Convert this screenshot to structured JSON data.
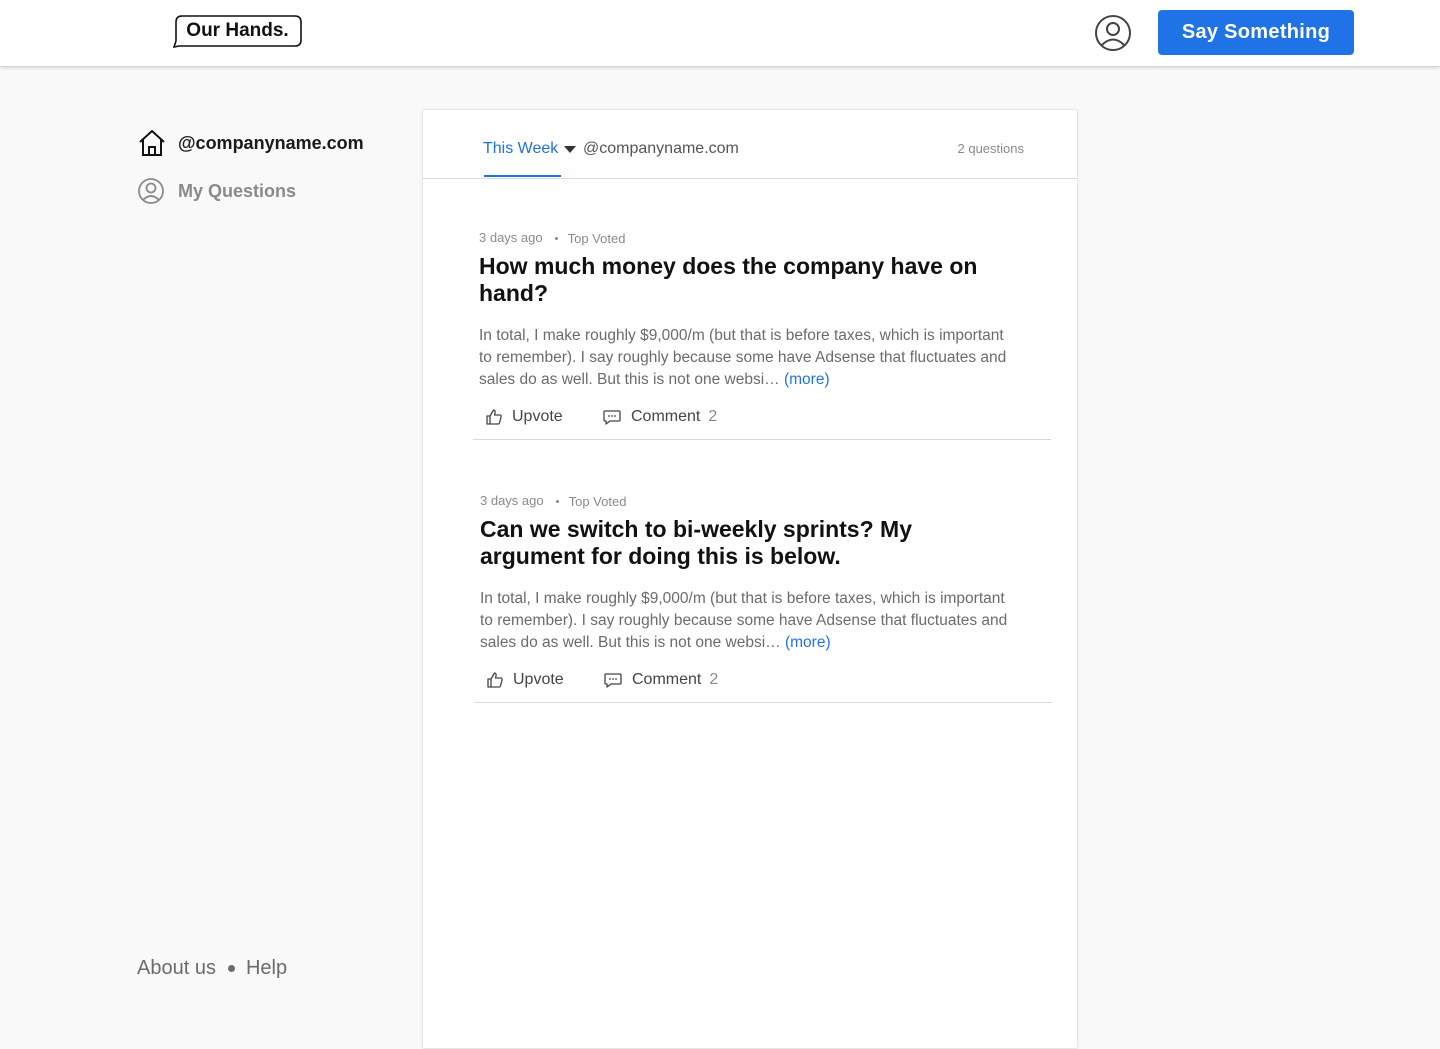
{
  "header": {
    "logo_text": "Our Hands.",
    "cta_label": "Say Something"
  },
  "sidebar": {
    "items": [
      {
        "label": "@companyname.com",
        "icon": "home-icon"
      },
      {
        "label": "My Questions",
        "icon": "user-circle-icon"
      }
    ]
  },
  "feed": {
    "filter_label": "This Week",
    "scope_label": "@companyname.com",
    "question_count": "2 questions",
    "posts": [
      {
        "age": "3 days ago",
        "tag": "Top Voted",
        "title": "How much money does the company have on hand?",
        "body": "In total, I make roughly $9,000/m (but that is before taxes, which is important to remember). I say roughly because some have Adsense that fluctuates and sales do as well. But this is not one websi… ",
        "more": "(more)",
        "upvote": "Upvote",
        "comment": "Comment",
        "comment_count": "2"
      },
      {
        "age": "3 days ago",
        "tag": "Top Voted",
        "title": "Can we switch to bi-weekly sprints? My argument for doing this is below.",
        "body": "In total, I make roughly $9,000/m (but that is before taxes, which is important to remember). I say roughly because some have Adsense that fluctuates and sales do as well. But this is not one websi… ",
        "more": "(more)",
        "upvote": "Upvote",
        "comment": "Comment",
        "comment_count": "2"
      }
    ]
  },
  "footer": {
    "about": "About us",
    "help": "Help"
  },
  "colors": {
    "accent": "#1f73e6",
    "background": "#f9f9f9"
  }
}
